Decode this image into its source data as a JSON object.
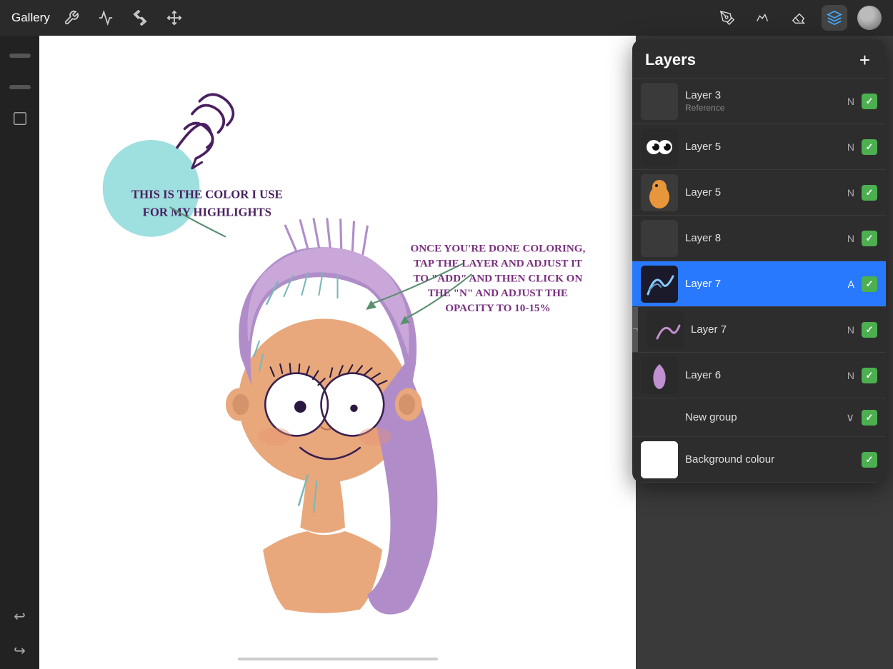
{
  "toolbar": {
    "gallery_label": "Gallery",
    "tools": [
      {
        "name": "wrench",
        "icon": "⚙"
      },
      {
        "name": "adjust",
        "icon": "✦"
      },
      {
        "name": "selection",
        "icon": "S"
      },
      {
        "name": "transform",
        "icon": "↗"
      }
    ],
    "right_tools": [
      {
        "name": "pen",
        "label": "pen-tool"
      },
      {
        "name": "ink",
        "label": "ink-tool"
      },
      {
        "name": "eraser",
        "label": "eraser-tool"
      },
      {
        "name": "layers",
        "label": "layers-tool",
        "active": true
      }
    ]
  },
  "layers_panel": {
    "title": "Layers",
    "add_label": "+",
    "layers": [
      {
        "id": "layer3",
        "name": "Layer 3",
        "sublabel": "Reference",
        "blend": "N",
        "checked": true,
        "thumb": "dark"
      },
      {
        "id": "layer5a",
        "name": "Layer 5",
        "sublabel": "",
        "blend": "N",
        "checked": true,
        "thumb": "eyes"
      },
      {
        "id": "layer5b",
        "name": "Layer 5",
        "sublabel": "",
        "blend": "N",
        "checked": true,
        "thumb": "chicken"
      },
      {
        "id": "layer8",
        "name": "Layer 8",
        "sublabel": "",
        "blend": "N",
        "checked": true,
        "thumb": "dark"
      },
      {
        "id": "layer7a",
        "name": "Layer 7",
        "sublabel": "",
        "blend": "A",
        "checked": true,
        "thumb": "strokes_active",
        "active": true
      },
      {
        "id": "layer7b",
        "name": "Layer 7",
        "sublabel": "",
        "blend": "N",
        "checked": true,
        "thumb": "strokes2"
      },
      {
        "id": "layer6",
        "name": "Layer 6",
        "sublabel": "",
        "blend": "N",
        "checked": true,
        "thumb": "purple_stroke"
      }
    ],
    "group": {
      "name": "New group",
      "chevron": "∨",
      "checked": true
    },
    "background": {
      "name": "Background colour",
      "checked": true,
      "color": "#ffffff"
    }
  },
  "canvas": {
    "annotation1": "THIS IS THE COLOR I USE\nFOR MY HIGHLIGHTS",
    "annotation2": "ONCE YOU'RE DONE COLORING,\nTAP THE LAYER AND ADJUST IT\nTO \"ADD\" AND THEN CLICK ON\nTHE \"N\" AND ADJUST THE\nOPACITY TO 10-15%"
  }
}
